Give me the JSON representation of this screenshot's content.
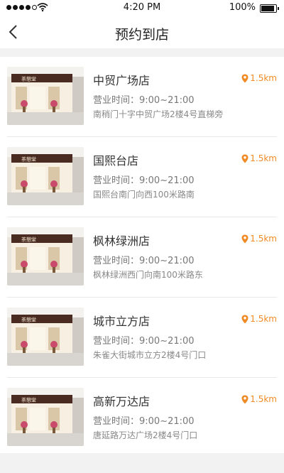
{
  "status_bar": {
    "time": "4:20 PM",
    "battery": "100%",
    "battery_level": 1.0
  },
  "nav": {
    "title": "预约到店",
    "back_icon": "chevron-left-icon"
  },
  "colors": {
    "accent": "#f08a24"
  },
  "stores": [
    {
      "name": "中贸广场店",
      "distance": "1.5km",
      "hours": "营业时间：9:00~21:00",
      "address": "南稍门十字中贸广场2楼4号直梯旁",
      "thumb_sign": "茶憩堂"
    },
    {
      "name": "国熙台店",
      "distance": "1.5km",
      "hours": "营业时间：9:00~21:00",
      "address": "国熙台南门向西100米路南",
      "thumb_sign": "茶憩堂"
    },
    {
      "name": "枫林绿洲店",
      "distance": "1.5km",
      "hours": "营业时间：9:00~21:00",
      "address": "枫林绿洲西门向南100米路东",
      "thumb_sign": "茶憩堂"
    },
    {
      "name": "城市立方店",
      "distance": "1.5km",
      "hours": "营业时间：9:00~21:00",
      "address": "朱雀大街城市立方2楼4号门口",
      "thumb_sign": "茶憩堂"
    },
    {
      "name": "高新万达店",
      "distance": "1.5km",
      "hours": "营业时间：9:00~21:00",
      "address": "唐延路万达广场2楼4号门口",
      "thumb_sign": "茶憩堂"
    }
  ]
}
